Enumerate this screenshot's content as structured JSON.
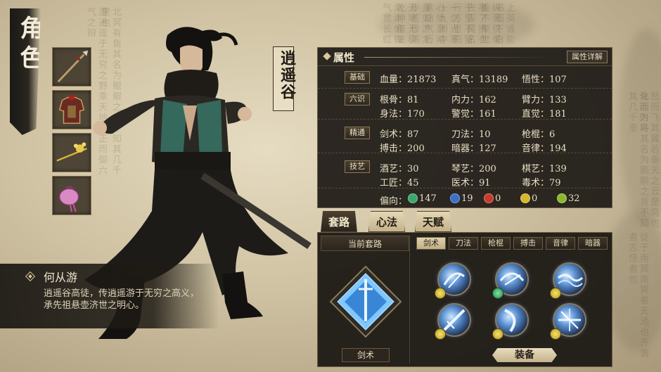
{
  "page": {
    "title": "角色"
  },
  "equipment_slots": [
    {
      "name": "weapon",
      "icon": "spear-icon"
    },
    {
      "name": "armor",
      "icon": "armor-icon"
    },
    {
      "name": "accessory",
      "icon": "hairpin-icon"
    },
    {
      "name": "pouch",
      "icon": "pouch-icon"
    }
  ],
  "character": {
    "sect": "逍遥谷",
    "name": "何从游",
    "description": "逍遥谷高徒，传逍遥游于无穷之高义，承先祖悬壶济世之明心。"
  },
  "attributes": {
    "title": "属性",
    "detail_button": "属性详解",
    "groups": [
      {
        "tag": "基础",
        "rows": [
          [
            "血量：21873",
            "真气：13189",
            "悟性：107"
          ]
        ]
      },
      {
        "tag": "六识",
        "rows": [
          [
            "根骨：81",
            "内力：162",
            "臂力：133"
          ],
          [
            "身法：170",
            "警觉：161",
            "直觉：181"
          ]
        ]
      },
      {
        "tag": "精通",
        "rows": [
          [
            "剑术：87",
            "刀法：10",
            "枪棍：6"
          ],
          [
            "搏击：200",
            "暗器：127",
            "音律：194"
          ]
        ]
      },
      {
        "tag": "技艺",
        "rows": [
          [
            "酒艺：30",
            "琴艺：200",
            "棋艺：139"
          ],
          [
            "工匠：45",
            "医术：91",
            "毒术：79"
          ]
        ]
      }
    ],
    "orientation": {
      "label": "偏向：",
      "items": [
        {
          "glyph": "阴",
          "value": "147",
          "color": "#3aa86a"
        },
        {
          "glyph": "柔",
          "value": "19",
          "color": "#3b6fc8"
        },
        {
          "glyph": "阳",
          "value": "0",
          "color": "#c83a2a"
        },
        {
          "glyph": "刚",
          "value": "0",
          "color": "#d6b62a"
        },
        {
          "glyph": "调",
          "value": "32",
          "color": "#8ab82a"
        }
      ]
    }
  },
  "tabs": [
    {
      "label": "套路",
      "active": true
    },
    {
      "label": "心法",
      "active": false
    },
    {
      "label": "天赋",
      "active": false
    }
  ],
  "current_routine": {
    "header": "当前套路",
    "name": "剑术"
  },
  "filters": [
    {
      "label": "剑术",
      "active": true
    },
    {
      "label": "刀法",
      "active": false
    },
    {
      "label": "枪棍",
      "active": false
    },
    {
      "label": "搏击",
      "active": false
    },
    {
      "label": "音律",
      "active": false
    },
    {
      "label": "暗器",
      "active": false
    }
  ],
  "skills": [
    {
      "icon": "sword-swirl-icon",
      "mark": "yellow"
    },
    {
      "icon": "sword-arc-icon",
      "mark": "green"
    },
    {
      "icon": "sword-wave-icon",
      "mark": "yellow"
    },
    {
      "icon": "sword-slash-icon",
      "mark": "yellow"
    },
    {
      "icon": "sword-crescent-icon",
      "mark": "yellow"
    },
    {
      "icon": "sword-burst-icon",
      "mark": "yellow"
    }
  ],
  "equip_button": "装备",
  "colors": {
    "panel": "#221e19",
    "accent": "#d9c99e",
    "parchment": "#d8cdb0"
  }
}
